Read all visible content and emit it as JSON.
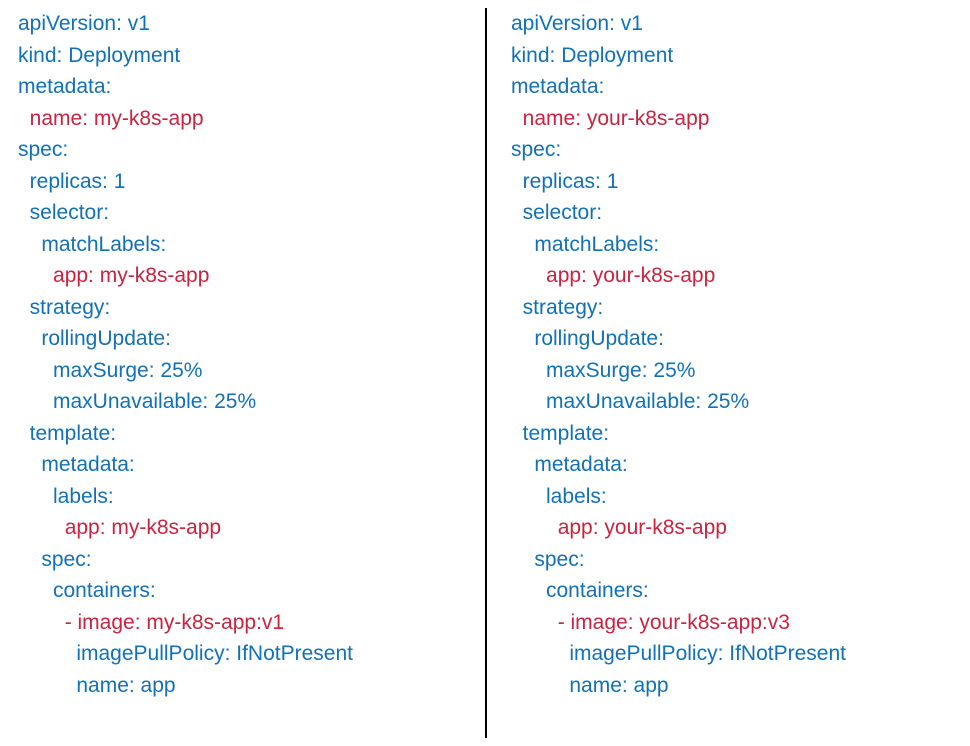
{
  "left": {
    "l1": "apiVersion: v1",
    "l2": "kind: Deployment",
    "l3": "metadata:",
    "l4_pre": "  ",
    "l4_diff": "name: my-k8s-app",
    "l5": "spec:",
    "l6": "  replicas: 1",
    "l7": "  selector:",
    "l8": "    matchLabels:",
    "l9_pre": "      ",
    "l9_diff": "app: my-k8s-app",
    "l10": "  strategy:",
    "l11": "    rollingUpdate:",
    "l12": "      maxSurge: 25%",
    "l13": "      maxUnavailable: 25%",
    "l14": "  template:",
    "l15": "    metadata:",
    "l16": "      labels:",
    "l17_pre": "        ",
    "l17_diff": "app: my-k8s-app",
    "l18": "    spec:",
    "l19": "      containers:",
    "l20_pre": "        ",
    "l20_diff": "- image: my-k8s-app:v1",
    "l21": "          imagePullPolicy: IfNotPresent",
    "l22": "          name: app"
  },
  "right": {
    "l1": "apiVersion: v1",
    "l2": "kind: Deployment",
    "l3": "metadata:",
    "l4_pre": "  ",
    "l4_diff": "name: your-k8s-app",
    "l5": "spec:",
    "l6": "  replicas: 1",
    "l7": "  selector:",
    "l8": "    matchLabels:",
    "l9_pre": "      ",
    "l9_diff": "app: your-k8s-app",
    "l10": "  strategy:",
    "l11": "    rollingUpdate:",
    "l12": "      maxSurge: 25%",
    "l13": "      maxUnavailable: 25%",
    "l14": "  template:",
    "l15": "    metadata:",
    "l16": "      labels:",
    "l17_pre": "        ",
    "l17_diff": "app: your-k8s-app",
    "l18": "    spec:",
    "l19": "      containers:",
    "l20_pre": "        ",
    "l20_diff": "- image: your-k8s-app:v3",
    "l21": "          imagePullPolicy: IfNotPresent",
    "l22": "          name: app"
  }
}
